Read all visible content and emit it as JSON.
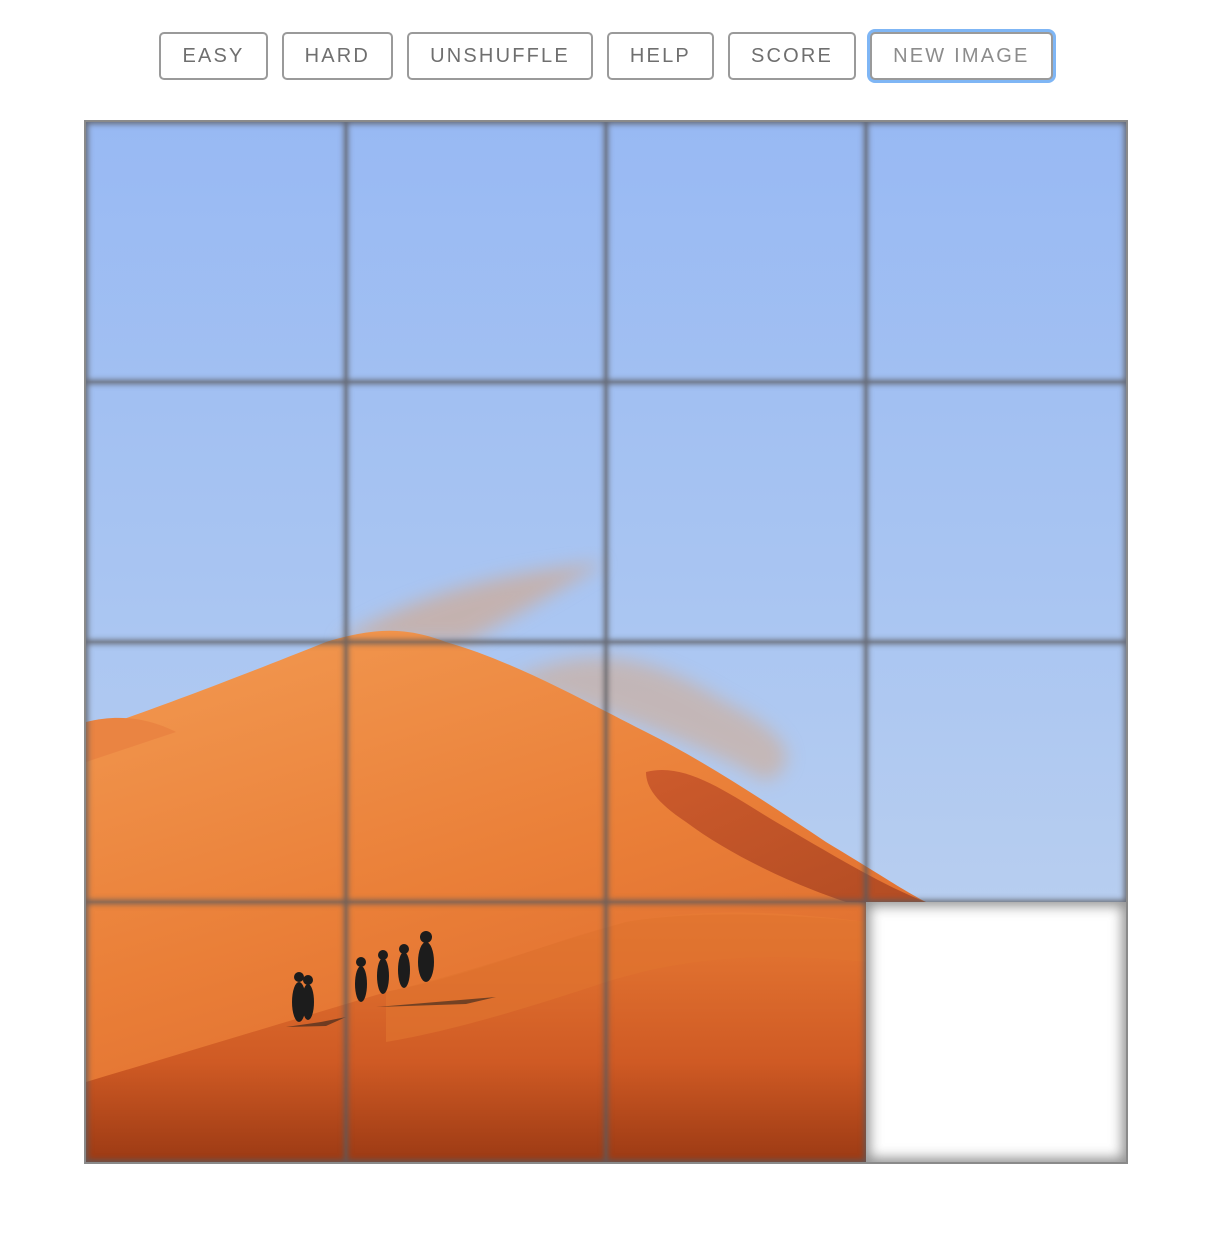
{
  "toolbar": {
    "buttons": [
      {
        "label": "EASY"
      },
      {
        "label": "HARD"
      },
      {
        "label": "UNSHUFFLE"
      },
      {
        "label": "HELP"
      },
      {
        "label": "SCORE"
      },
      {
        "label": "NEW IMAGE"
      }
    ]
  },
  "puzzle": {
    "grid_size": 4,
    "image_subject": "desert sand dunes with hikers",
    "tiles": [
      {
        "row": 0,
        "col": 0,
        "piece": 0
      },
      {
        "row": 0,
        "col": 1,
        "piece": 1
      },
      {
        "row": 0,
        "col": 2,
        "piece": 2
      },
      {
        "row": 0,
        "col": 3,
        "piece": 3
      },
      {
        "row": 1,
        "col": 0,
        "piece": 4
      },
      {
        "row": 1,
        "col": 1,
        "piece": 5
      },
      {
        "row": 1,
        "col": 2,
        "piece": 6
      },
      {
        "row": 1,
        "col": 3,
        "piece": 7
      },
      {
        "row": 2,
        "col": 0,
        "piece": 8
      },
      {
        "row": 2,
        "col": 1,
        "piece": 9
      },
      {
        "row": 2,
        "col": 2,
        "piece": 10
      },
      {
        "row": 2,
        "col": 3,
        "piece": 11
      },
      {
        "row": 3,
        "col": 0,
        "piece": 12
      },
      {
        "row": 3,
        "col": 1,
        "piece": 13
      },
      {
        "row": 3,
        "col": 2,
        "piece": 14
      },
      {
        "row": 3,
        "col": 3,
        "piece": null
      }
    ],
    "colors": {
      "sky_top": "#9cbcf5",
      "sky_bottom": "#bfd3ef",
      "sand_light": "#f0924a",
      "sand_mid": "#e2702e",
      "sand_dark": "#a8421a",
      "hikers": "#1c1c1c"
    }
  }
}
